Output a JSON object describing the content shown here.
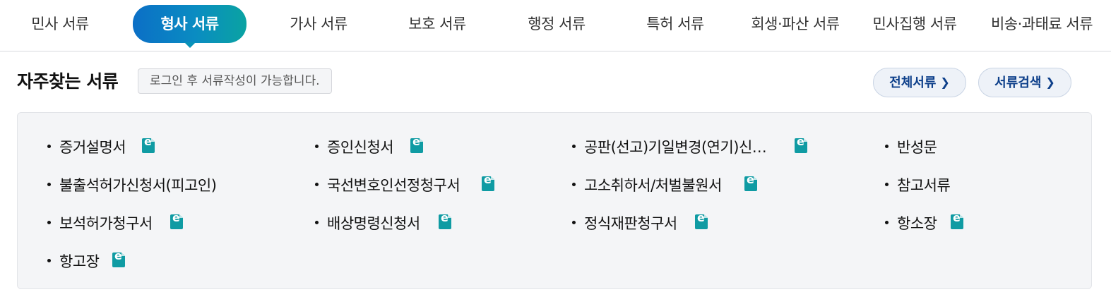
{
  "tabs": [
    {
      "label": "민사 서류"
    },
    {
      "label": "형사 서류",
      "active": true
    },
    {
      "label": "가사 서류"
    },
    {
      "label": "보호 서류"
    },
    {
      "label": "행정 서류"
    },
    {
      "label": "특허 서류"
    },
    {
      "label": "회생·파산 서류"
    },
    {
      "label": "민사집행 서류"
    },
    {
      "label": "비송·과태료 서류"
    }
  ],
  "section": {
    "title": "자주찾는 서류",
    "login_note": "로그인 후 서류작성이 가능합니다.",
    "all_docs_button": "전체서류",
    "search_button": "서류검색"
  },
  "documents": [
    {
      "label": "증거설명서",
      "e_form": true
    },
    {
      "label": "증인신청서",
      "e_form": true
    },
    {
      "label": "공판(선고)기일변경(연기)신…",
      "e_form": true
    },
    {
      "label": "반성문",
      "e_form": false
    },
    {
      "label": "불출석허가신청서(피고인)",
      "e_form": false
    },
    {
      "label": "국선변호인선정청구서",
      "e_form": true
    },
    {
      "label": "고소취하서/처벌불원서",
      "e_form": true
    },
    {
      "label": "참고서류",
      "e_form": false
    },
    {
      "label": "보석허가청구서",
      "e_form": true
    },
    {
      "label": "배상명령신청서",
      "e_form": true
    },
    {
      "label": "정식재판청구서",
      "e_form": true
    },
    {
      "label": "항소장",
      "e_form": true
    },
    {
      "label": "항고장",
      "e_form": true
    }
  ],
  "icons": {
    "e_form": "e-document-icon",
    "chevron": "chevron-right-icon"
  },
  "colors": {
    "tab_active_start": "#0b6fc6",
    "tab_active_end": "#0aa3a2",
    "pill_text": "#0d3f8a",
    "e_icon": "#0f9ba3"
  }
}
